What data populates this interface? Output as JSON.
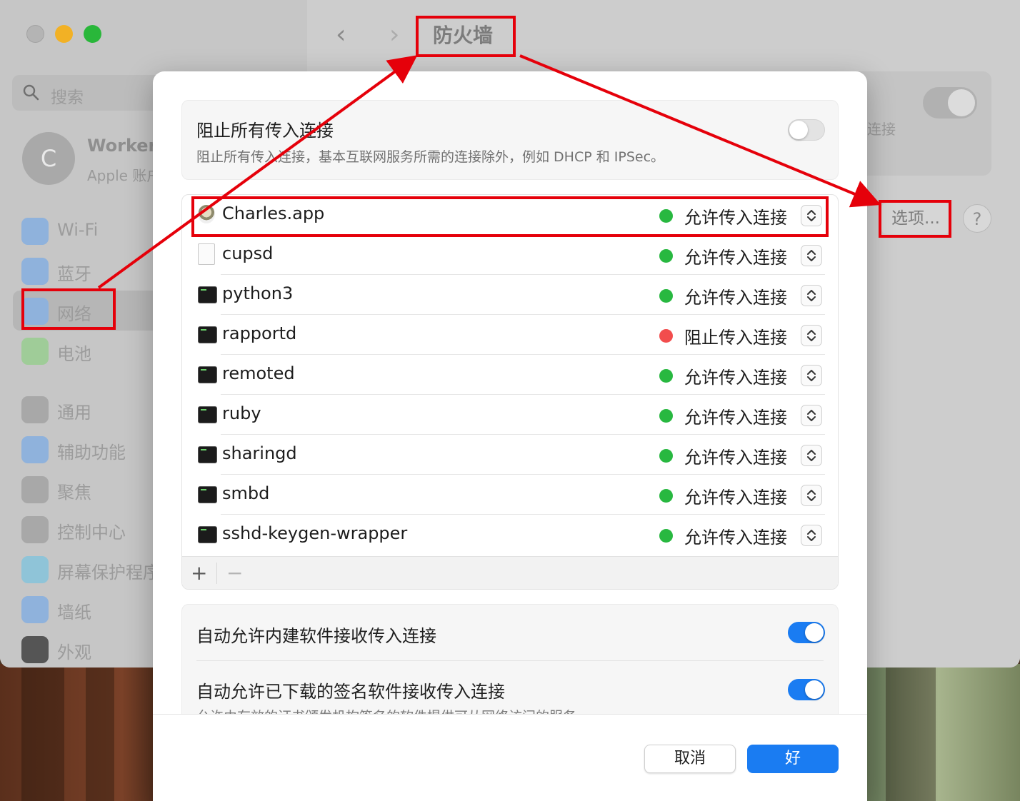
{
  "window": {
    "title": "防火墙",
    "search_placeholder": "搜索",
    "account": {
      "initial": "C",
      "name": "Worker",
      "subtitle": "Apple 账户"
    },
    "sidebar": [
      {
        "label": "Wi-Fi",
        "icon": "wifi-icon",
        "color": "#8fb2dc"
      },
      {
        "label": "蓝牙",
        "icon": "bluetooth-icon",
        "color": "#8fb2dc"
      },
      {
        "label": "网络",
        "icon": "network-globe-icon",
        "color": "#8fb2dc",
        "selected": true
      },
      {
        "label": "电池",
        "icon": "battery-icon",
        "color": "#9fcc98"
      },
      {
        "label": "通用",
        "icon": "gear-icon",
        "color": "#a8a8a8"
      },
      {
        "label": "辅助功能",
        "icon": "accessibility-icon",
        "color": "#8fb2dc"
      },
      {
        "label": "聚焦",
        "icon": "magnifier-icon",
        "color": "#a8a8a8"
      },
      {
        "label": "控制中心",
        "icon": "control-center-icon",
        "color": "#a8a8a8"
      },
      {
        "label": "屏幕保护程序",
        "icon": "screensaver-icon",
        "color": "#8fc4d8"
      },
      {
        "label": "墙纸",
        "icon": "wallpaper-flower-icon",
        "color": "#8fb2dc"
      },
      {
        "label": "外观",
        "icon": "appearance-icon",
        "color": "#555555"
      }
    ],
    "main_partial_text": "连接",
    "options_label": "选项...",
    "help_label": "?"
  },
  "sheet": {
    "block_all": {
      "title": "阻止所有传入连接",
      "description": "阻止所有传入连接，基本互联网服务所需的连接除外，例如 DHCP 和 IPSec。",
      "enabled": false
    },
    "apps": [
      {
        "name": "Charles.app",
        "icon": "charles-app-icon",
        "status": "允许传入连接",
        "status_color": "#28b840"
      },
      {
        "name": "cupsd",
        "icon": "document-icon",
        "status": "允许传入连接",
        "status_color": "#28b840"
      },
      {
        "name": "python3",
        "icon": "terminal-icon",
        "status": "允许传入连接",
        "status_color": "#28b840"
      },
      {
        "name": "rapportd",
        "icon": "terminal-icon",
        "status": "阻止传入连接",
        "status_color": "#f24d4d"
      },
      {
        "name": "remoted",
        "icon": "terminal-icon",
        "status": "允许传入连接",
        "status_color": "#28b840"
      },
      {
        "name": "ruby",
        "icon": "terminal-icon",
        "status": "允许传入连接",
        "status_color": "#28b840"
      },
      {
        "name": "sharingd",
        "icon": "terminal-icon",
        "status": "允许传入连接",
        "status_color": "#28b840"
      },
      {
        "name": "smbd",
        "icon": "terminal-icon",
        "status": "允许传入连接",
        "status_color": "#28b840"
      },
      {
        "name": "sshd-keygen-wrapper",
        "icon": "terminal-icon",
        "status": "允许传入连接",
        "status_color": "#28b840"
      }
    ],
    "add_label": "+",
    "remove_label": "−",
    "auto_builtin": {
      "label": "自动允许内建软件接收传入连接",
      "enabled": true
    },
    "auto_signed": {
      "label": "自动允许已下载的签名软件接收传入连接",
      "description": "允许由有效的证书颁发机构签名的软件提供可从网络访问的服务。",
      "enabled": true
    },
    "cancel_label": "取消",
    "ok_label": "好"
  },
  "colors": {
    "accent": "#1a7cf2",
    "annotation": "#e5000a"
  }
}
